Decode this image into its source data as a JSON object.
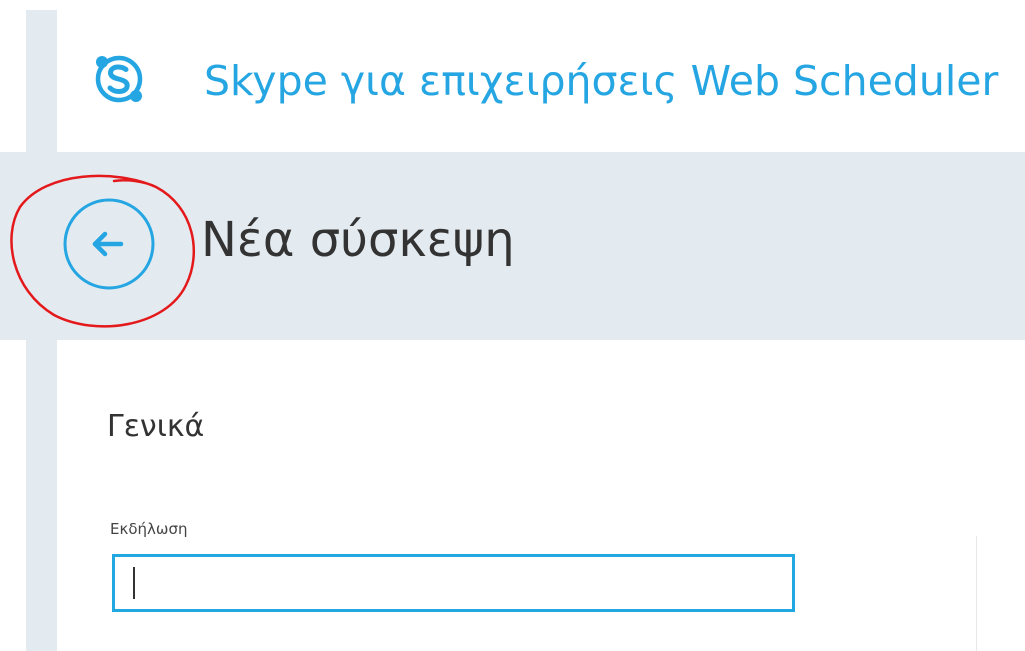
{
  "header": {
    "app_title": "Skype για επιχειρήσεις Web Scheduler",
    "logo_icon": "skype-logo-icon"
  },
  "page": {
    "title": "Νέα σύσκεψη",
    "back_icon": "back-arrow-icon"
  },
  "content": {
    "section_title": "Γενικά",
    "event_field": {
      "label": "Εκδήλωση",
      "value": "",
      "placeholder": ""
    }
  },
  "colors": {
    "accent": "#25a6e2",
    "band": "#e4ebf0",
    "annotation": "#e3191b",
    "text": "#333333"
  }
}
